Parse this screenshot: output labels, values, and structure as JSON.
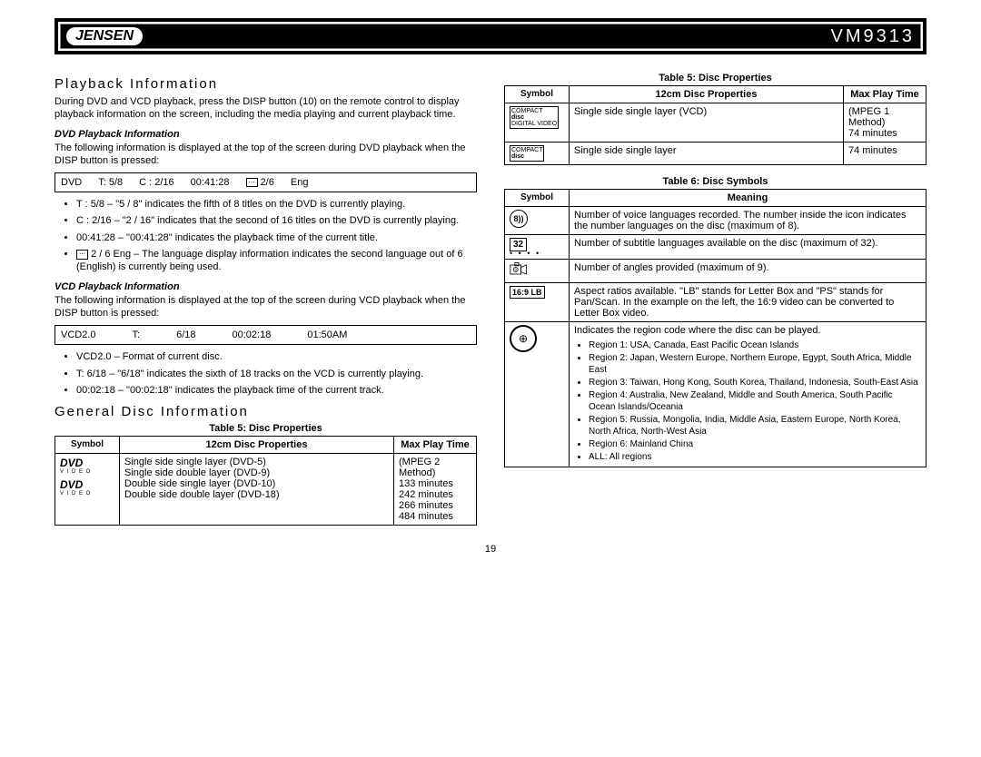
{
  "header": {
    "brand": "JENSEN",
    "model": "VM9313"
  },
  "left": {
    "section1_title": "Playback Information",
    "intro": "During DVD and VCD playback, press the DISP button (10) on the remote control to display playback information on the screen, including the media playing and current playback time.",
    "dvd_sub": "DVD Playback Information",
    "dvd_p": "The following information is displayed at the top of the screen during DVD playback when the DISP button is pressed:",
    "dvd_box": {
      "a": "DVD",
      "b": "T:  5/8",
      "c": "C : 2/16",
      "d": "00:41:28",
      "e": "2/6",
      "f": "Eng"
    },
    "dvd_bullets": [
      "T : 5/8 – \"5 / 8\" indicates the fifth of 8 titles on the DVD is currently playing.",
      "C : 2/16 – \"2 / 16\" indicates that the second of 16 titles on the DVD is currently playing.",
      "00:41:28 – \"00:41:28\" indicates the playback time of the current title.",
      "2 / 6 Eng – The language display information indicates the second language out of 6 (English) is currently being used."
    ],
    "vcd_sub": "VCD Playback Information",
    "vcd_p": "The following information is displayed at the top of the screen during VCD playback when the DISP button is pressed:",
    "vcd_box": {
      "a": "VCD2.0",
      "b": "T:",
      "c": "6/18",
      "d": "00:02:18",
      "e": "01:50AM"
    },
    "vcd_bullets": [
      "VCD2.0 – Format of current disc.",
      "T: 6/18 – \"6/18\" indicates the sixth of 18 tracks on the VCD is currently playing.",
      "00:02:18 – \"00:02:18\" indicates the playback time of the current track."
    ],
    "section2_title": "General Disc Information",
    "table5_caption": "Table 5: Disc Properties",
    "table5_headers": {
      "sym": "Symbol",
      "prop": "12cm Disc Properties",
      "time": "Max Play Time"
    },
    "table5_left": {
      "sym": "DVD",
      "sym_sub": "V I D E O",
      "props": [
        "Single side single layer (DVD-5)",
        "Single side double layer (DVD-9)",
        "Double side single layer (DVD-10)",
        "Double side double layer (DVD-18)"
      ],
      "time": "(MPEG 2 Method)\n133 minutes\n242 minutes\n266 minutes\n484 minutes"
    }
  },
  "right": {
    "table5_caption": "Table 5: Disc Properties",
    "table5_headers": {
      "sym": "Symbol",
      "prop": "12cm Disc Properties",
      "time": "Max Play Time"
    },
    "table5_rows": [
      {
        "sym_top": "COMPACT",
        "sym_bot": "DIGITAL VIDEO",
        "prop": "Single side single layer (VCD)",
        "time": "(MPEG 1 Method)\n74 minutes"
      },
      {
        "sym_top": "COMPACT",
        "sym_bot": "",
        "prop": "Single side single layer",
        "time": "74 minutes"
      }
    ],
    "table6_caption": "Table 6: Disc Symbols",
    "table6_headers": {
      "sym": "Symbol",
      "mean": "Meaning"
    },
    "table6_rows": {
      "r1_sym": "8",
      "r1": "Number of voice languages recorded. The number inside the icon indicates the number languages on the disc (maximum of 8).",
      "r2_sym": "32",
      "r2": "Number of subtitle languages available on the disc (maximum of 32).",
      "r3_sym": "9",
      "r3": "Number of angles provided (maximum of 9).",
      "r4_sym": "16:9 LB",
      "r4": "Aspect ratios available. \"LB\" stands for Letter Box and \"PS\" stands for Pan/Scan. In the example on the left, the 16:9 video can be converted to Letter Box video.",
      "r5_intro": "Indicates the region code where the disc can be played.",
      "r5_regions": [
        "Region 1: USA, Canada, East Pacific Ocean Islands",
        "Region 2: Japan, Western Europe, Northern Europe, Egypt, South Africa, Middle East",
        "Region 3: Taiwan, Hong Kong, South Korea, Thailand, Indonesia, South-East Asia",
        "Region 4: Australia, New Zealand, Middle and South America, South Pacific Ocean Islands/Oceania",
        "Region 5: Russia, Mongolia, India, Middle Asia, Eastern Europe, North Korea, North Africa, North-West Asia",
        "Region 6: Mainland China",
        "ALL: All regions"
      ]
    }
  },
  "page_number": "19"
}
